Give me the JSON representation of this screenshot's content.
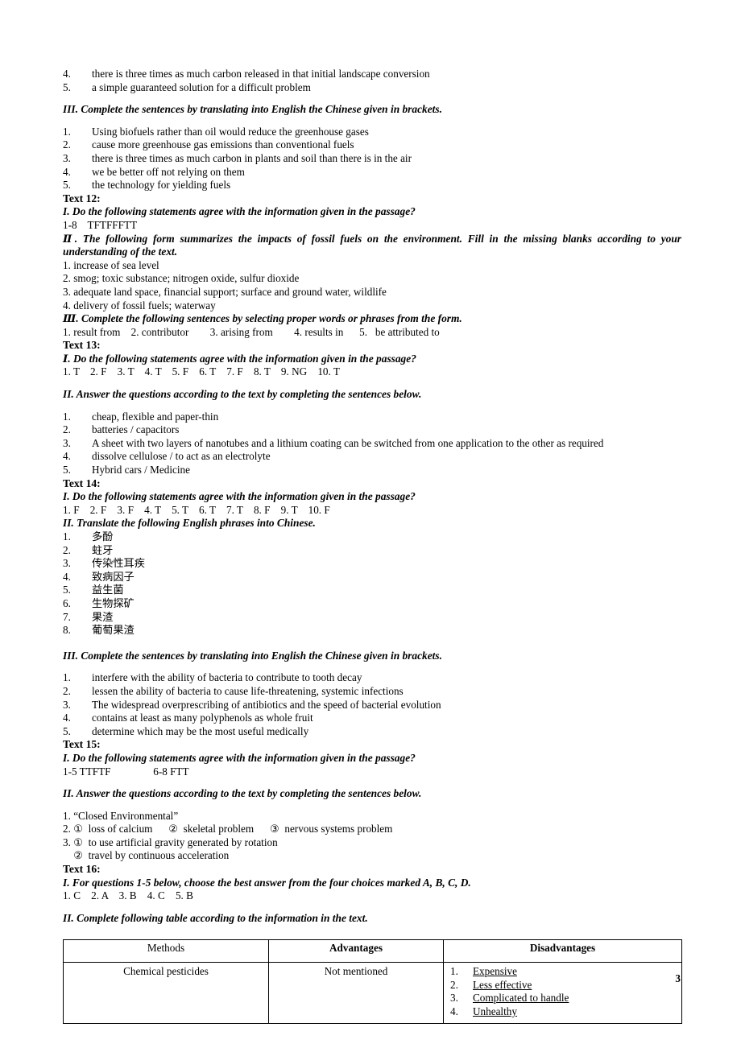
{
  "page": {
    "number": "3"
  },
  "top_list": {
    "items": [
      {
        "num": "4.",
        "text": "there is three times as much carbon released in that initial landscape conversion"
      },
      {
        "num": "5.",
        "text": "a simple guaranteed solution for a difficult problem"
      }
    ]
  },
  "section_translate_1": {
    "heading": "III. Complete the sentences by translating into English the Chinese given in brackets.",
    "items": [
      {
        "num": "1.",
        "text": "Using biofuels rather than oil would reduce the greenhouse gases"
      },
      {
        "num": "2.",
        "text": "cause more greenhouse gas emissions than conventional fuels"
      },
      {
        "num": "3.",
        "text": "there is three times as much carbon in plants and soil than there is in the air"
      },
      {
        "num": "4.",
        "text": "we be better off not relying on them"
      },
      {
        "num": "5.",
        "text": "the technology for yielding fuels"
      }
    ]
  },
  "text12": {
    "title": "Text 12:",
    "part1_heading": "I. Do the following statements agree with the information given in the passage?",
    "part1_answer": "1-8    TFTFFFTT",
    "part2_heading": "Ⅱ. The following form summarizes the impacts of fossil fuels on the environment. Fill in the missing blanks according to your understanding of the text.",
    "part2_answers": [
      "1. increase of sea level",
      "2. smog; toxic substance; nitrogen oxide, sulfur dioxide",
      "3. adequate land space, financial support; surface and ground water, wildlife",
      "4. delivery of fossil fuels; waterway"
    ],
    "part3_heading": "Ⅲ. Complete the following sentences by selecting proper words or phrases from the form.",
    "part3_answer": "1. result from    2. contributor        3. arising from        4. results in      5.   be attributed to"
  },
  "text13": {
    "title": "Text 13:",
    "part1_heading": " Ⅰ. Do the following statements agree with the information given in the passage?",
    "part1_answer": "1. T    2. F    3. T    4. T    5. F    6. T    7. F    8. T    9. NG    10. T",
    "part2_heading": "II. Answer the questions according to the text by completing the sentences below.",
    "part2_items": [
      {
        "num": "1.",
        "text": "cheap, flexible and paper-thin"
      },
      {
        "num": "2.",
        "text": "batteries / capacitors"
      },
      {
        "num": "3.",
        "text": "A sheet with two layers of nanotubes and a lithium coating can be switched from one application to the other as required"
      },
      {
        "num": "4.",
        "text": "dissolve cellulose / to act as an electrolyte"
      },
      {
        "num": "5.",
        "text": "Hybrid cars / Medicine"
      }
    ]
  },
  "text14": {
    "title": "Text 14:",
    "part1_heading": "I. Do the following statements agree with the information given in the passage?",
    "part1_answer": "1. F    2. F    3. F    4. T    5. T    6. T    7. T    8. F    9. T    10. F",
    "part2_heading": "II. Translate the following English phrases into Chinese.",
    "part2_items": [
      {
        "num": "1.",
        "text": "多酚"
      },
      {
        "num": "2.",
        "text": "蛀牙"
      },
      {
        "num": "3.",
        "text": "传染性耳疾"
      },
      {
        "num": "4.",
        "text": "致病因子"
      },
      {
        "num": "5.",
        "text": "益生菌"
      },
      {
        "num": "6.",
        "text": "生物探矿"
      },
      {
        "num": "7.",
        "text": "果渣"
      },
      {
        "num": "8.",
        "text": "葡萄果渣"
      }
    ],
    "part3_heading": "III. Complete the sentences by translating into English the Chinese given in brackets.",
    "part3_items": [
      {
        "num": "1.",
        "text": "interfere with the ability of bacteria to contribute to tooth decay"
      },
      {
        "num": "2.",
        "text": "lessen the ability of bacteria to cause life-threatening, systemic infections"
      },
      {
        "num": "3.",
        "text": "The widespread overprescribing of antibiotics and the speed of bacterial evolution"
      },
      {
        "num": "4.",
        "text": "contains at least as many polyphenols as whole fruit"
      },
      {
        "num": "5.",
        "text": "determine which may be the most useful medically"
      }
    ]
  },
  "text15": {
    "title": "Text 15:",
    "part1_heading": "I. Do the following statements agree with the information given in the passage?",
    "part1_answer": "1-5 TTFTF                6-8 FTT",
    "part2_heading": "II. Answer the questions according to the text by completing the sentences below.",
    "part2_answers": [
      "1. “Closed Environmental”",
      "2. ①  loss of calcium      ②  skeletal problem      ③  nervous systems problem",
      "3. ①  to use artificial gravity generated by rotation",
      "    ②  travel by continuous acceleration"
    ]
  },
  "text16": {
    "title": "Text 16:",
    "part1_heading": "I. For questions 1-5 below, choose the best answer from the four choices marked A, B, C, D.",
    "part1_answer": "1. C    2. A    3. B    4. C    5. B",
    "part2_heading": "II. Complete following table according to the information in the text.",
    "table": {
      "headers": [
        {
          "label": "Methods",
          "bold": false
        },
        {
          "label": "Advantages",
          "bold": true
        },
        {
          "label": "Disadvantages",
          "bold": true
        }
      ],
      "rows": [
        {
          "method": "Chemical pesticides",
          "advantage": "Not mentioned",
          "disadvantages": [
            {
              "num": "1.",
              "text": "Expensive"
            },
            {
              "num": "2.",
              "text": "Less effective"
            },
            {
              "num": "3.",
              "text": "Complicated to handle"
            },
            {
              "num": "4.",
              "text": "Unhealthy"
            }
          ]
        }
      ]
    }
  }
}
